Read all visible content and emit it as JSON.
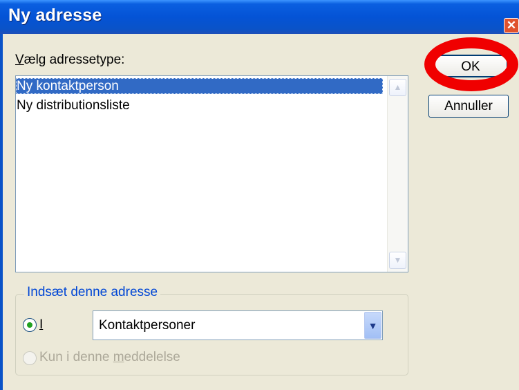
{
  "window": {
    "title": "Ny adresse",
    "close_symbol": "✕"
  },
  "list": {
    "label_prefix": "V",
    "label_rest": "ælg adressetype:",
    "items": [
      "Ny kontaktperson",
      "Ny distributionsliste"
    ],
    "selected_index": 0
  },
  "group": {
    "legend": "Indsæt denne adresse",
    "option1_label": "I",
    "option2_label_a": "Kun i denne ",
    "option2_label_u": "m",
    "option2_label_b": "eddelelse",
    "combo_value": "Kontaktpersoner"
  },
  "buttons": {
    "ok": "OK",
    "cancel": "Annuller"
  },
  "colors": {
    "annotation_ring": "#F00000",
    "titlebar": "#0453D6",
    "selection": "#316AC5"
  }
}
